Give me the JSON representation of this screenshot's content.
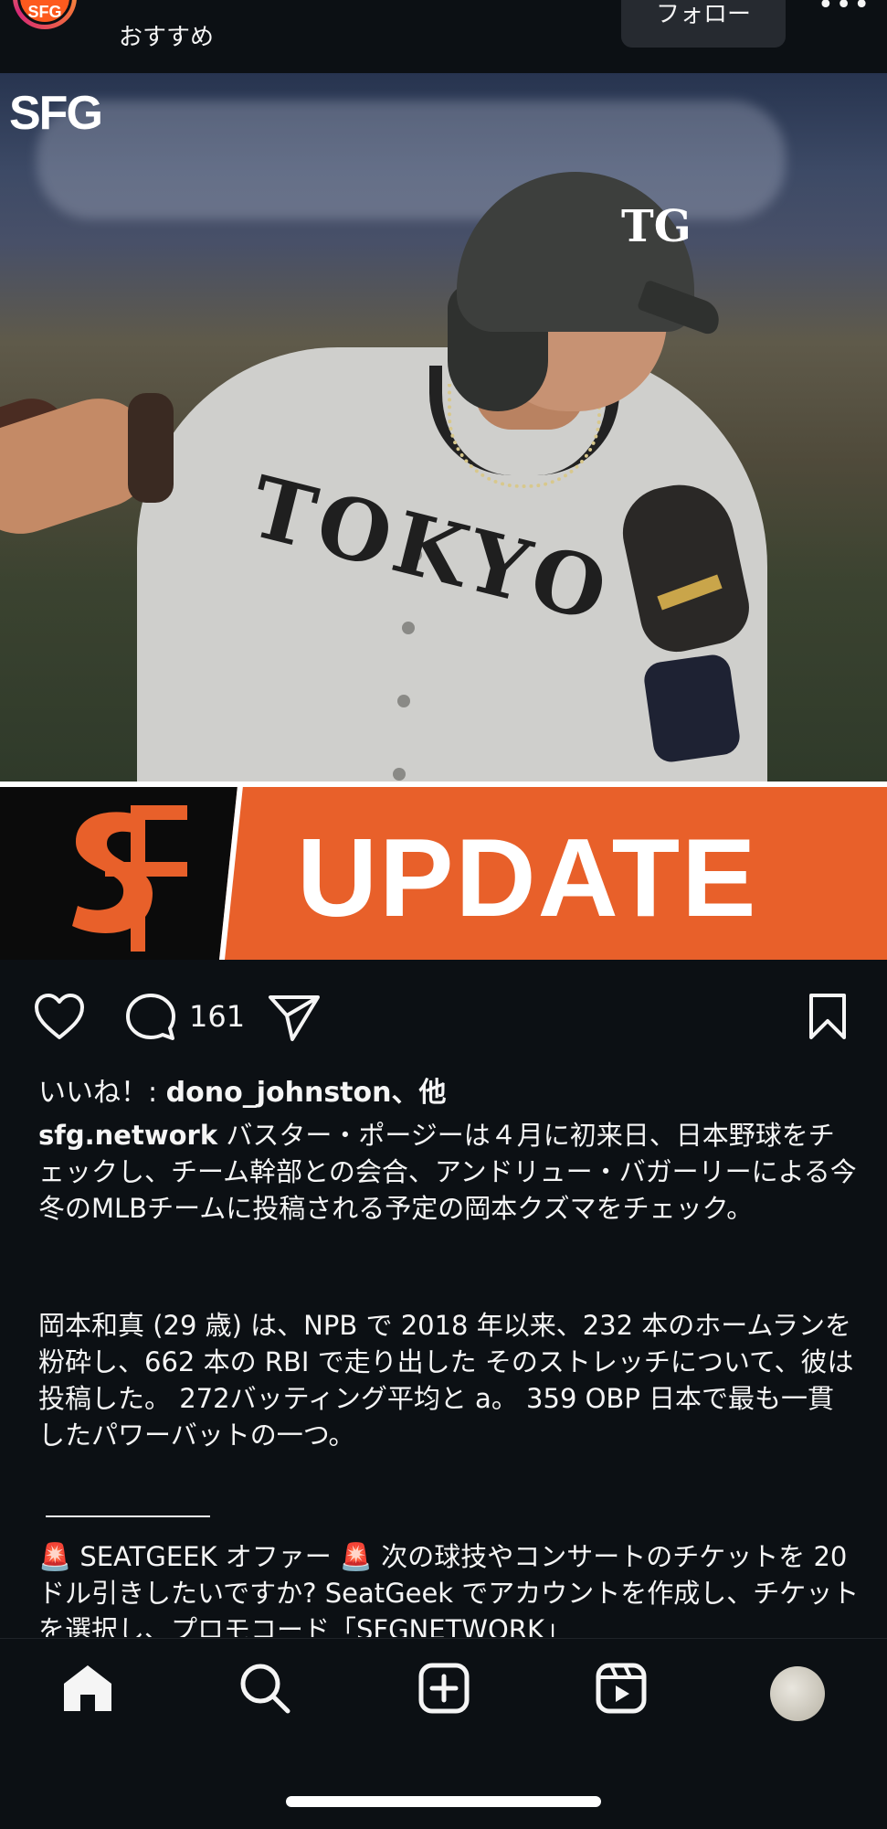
{
  "header": {
    "avatar_text": "SFG",
    "subtitle": "おすすめ",
    "follow_label": "フォロー",
    "more_label": "•••"
  },
  "post": {
    "image": {
      "corner_tag": "SFG",
      "jersey_text": "TOKYO",
      "helmet_logo": "TG",
      "banner_text": "UPDATE",
      "banner_colors": {
        "orange": "#e8602a",
        "black": "#0b0b0b"
      }
    },
    "actions": {
      "like_icon": "heart-icon",
      "comment_icon": "comment-icon",
      "comment_count": "161",
      "share_icon": "send-icon",
      "save_icon": "bookmark-icon"
    },
    "likes": {
      "prefix": "いいね！: ",
      "user": "dono_johnston",
      "suffix": "、他"
    },
    "caption": {
      "username": "sfg.network",
      "paragraph1": " バスター・ポージーは４月に初来日、日本野球をチェックし、チーム幹部との会合、アンドリュー・バガーリーによる今冬のMLBチームに投稿される予定の岡本クズマをチェック。",
      "paragraph2": "岡本和真 (29 歳) は、NPB で 2018 年以来、232 本のホームランを粉砕し、662 本の RBI で走り出した そのストレッチについて、彼は投稿した。 272バッティング平均と a。 359 OBP 日本で最も一貫したパワーバットの一つ。",
      "separator": "———————",
      "paragraph3": "🚨 SEATGEEK オファー 🚨 次の球技やコンサートのチケットを 20 ドル引きしたいですか? SeatGeek でアカウントを作成し、チケットを選択し、プロモコード「SFGNETWORK」"
    }
  },
  "bottom_nav": {
    "items": [
      "home-icon",
      "search-icon",
      "create-icon",
      "reels-icon",
      "profile-avatar"
    ]
  }
}
